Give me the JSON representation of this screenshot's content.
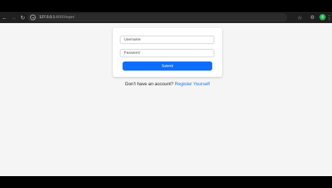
{
  "browser": {
    "url_host": "127.0.0.1",
    "url_path": ":8000/login/",
    "profile_initial": "8",
    "icons": {
      "back": "arrow-left-icon",
      "forward": "arrow-right-icon",
      "reload": "reload-icon",
      "site_info": "site-info-icon",
      "bookmark": "star-icon",
      "extensions": "extension-icon",
      "menu": "kebab-menu-icon"
    },
    "avatar_color": "#27b34a"
  },
  "login_form": {
    "username_placeholder": "Username",
    "password_placeholder": "Password",
    "submit_label": "Submit"
  },
  "register": {
    "prompt": "Don't have an account?",
    "link_label": "Register Yourself"
  },
  "colors": {
    "accent": "#0d6efd",
    "page_background": "#f5f5f5"
  }
}
